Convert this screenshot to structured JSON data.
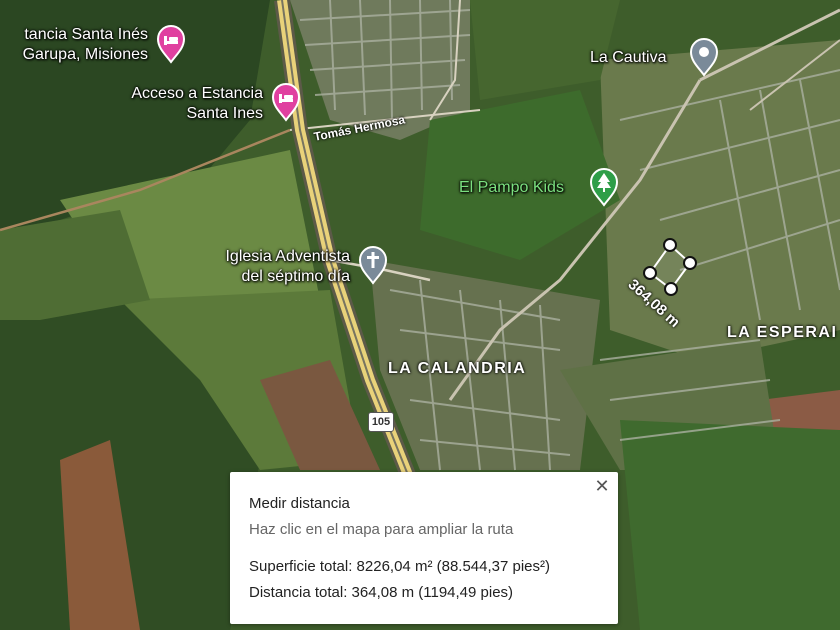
{
  "pois": {
    "santa_ines": {
      "name_line1": "tancia Santa Inés",
      "name_line2": "Garupa, Misiones",
      "icon": "hotel-icon",
      "color": "#e040a0"
    },
    "acceso": {
      "name_line1": "Acceso a Estancia",
      "name_line2": "Santa Ines",
      "icon": "hotel-icon",
      "color": "#e040a0"
    },
    "cautiva": {
      "name": "La Cautiva",
      "icon": "place-pin-icon",
      "color": "#7a8a99"
    },
    "pampo": {
      "name": "El Pampo Kids",
      "icon": "tree-icon",
      "color": "#2e9e48"
    },
    "iglesia": {
      "name_line1": "Iglesia Adventista",
      "name_line2": "del séptimo día",
      "icon": "church-icon",
      "color": "#7a8a99"
    }
  },
  "roads": {
    "tomas_hermosa": "Tomás Hermosa",
    "route_shield": "105"
  },
  "areas": {
    "la_calandria": "LA CALANDRIA",
    "la_esperanza": "LA ESPERAI"
  },
  "measurement": {
    "label": "364,08 m"
  },
  "panel": {
    "title": "Medir distancia",
    "hint": "Haz clic en el mapa para ampliar la ruta",
    "surface": "Superficie total: 8226,04 m² (88.544,37 pies²)",
    "distance": "Distancia total: 364,08 m (1194,49 pies)",
    "close_icon": "close-icon"
  }
}
